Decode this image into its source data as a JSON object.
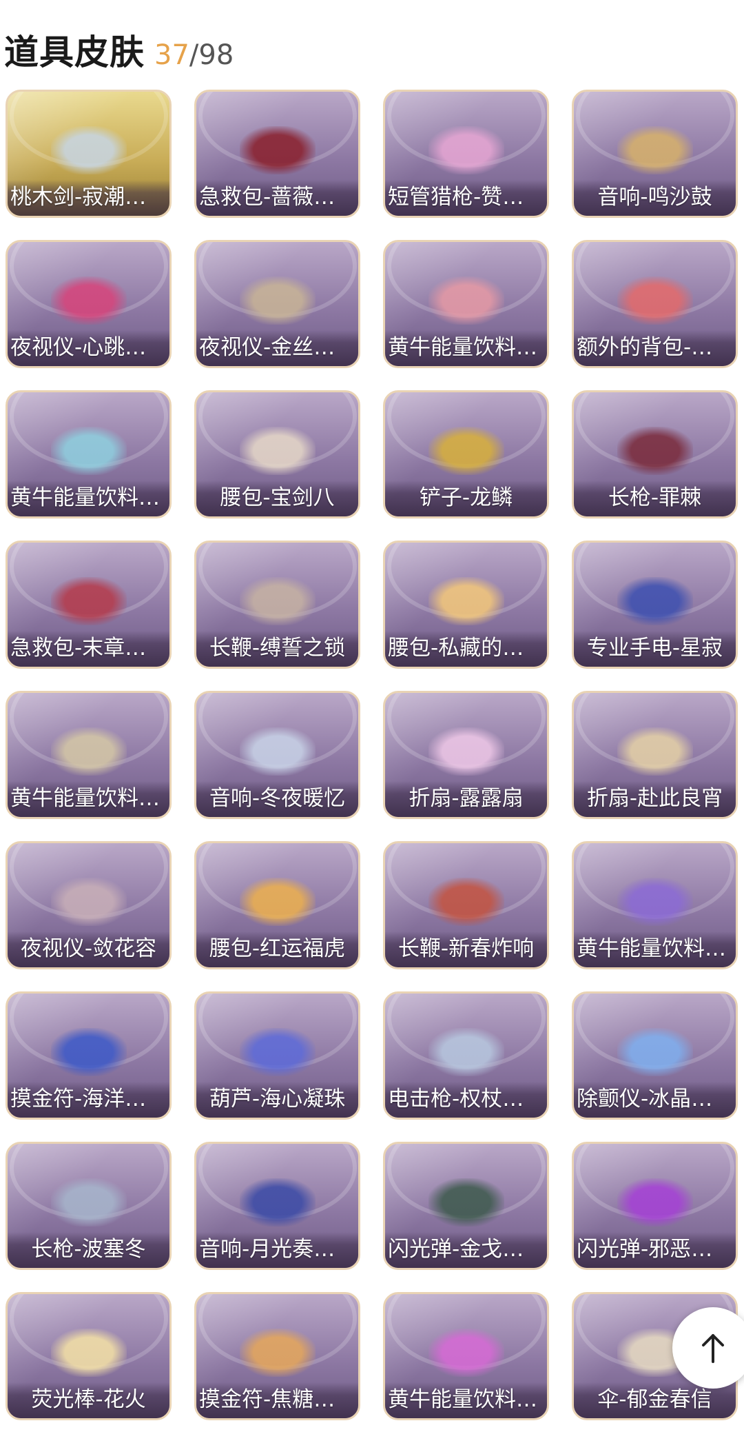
{
  "header": {
    "title": "道具皮肤",
    "owned": "37",
    "separator": "/",
    "total": "98"
  },
  "items": [
    {
      "label": "桃木剑-寂潮之…",
      "style": "gold",
      "art": "#c7d6e6"
    },
    {
      "label": "急救包-蔷薇物…",
      "style": "purple",
      "art": "#8a1f2b"
    },
    {
      "label": "短管猎枪-赞萌…",
      "style": "purple",
      "art": "#e8a7d4"
    },
    {
      "label": "音响-鸣沙鼓",
      "style": "purple",
      "art": "#d8b26a"
    },
    {
      "label": "夜视仪-心跳眼…",
      "style": "purple",
      "art": "#d8437a"
    },
    {
      "label": "夜视仪-金丝眼…",
      "style": "purple",
      "art": "#c9b596"
    },
    {
      "label": "黄牛能量饮料-…",
      "style": "purple",
      "art": "#e79aa5"
    },
    {
      "label": "额外的背包-飞…",
      "style": "purple",
      "art": "#e56a6a"
    },
    {
      "label": "黄牛能量饮料-…",
      "style": "purple",
      "art": "#8fd1e0"
    },
    {
      "label": "腰包-宝剑八",
      "style": "purple",
      "art": "#e7d9c8"
    },
    {
      "label": "铲子-龙鳞",
      "style": "purple",
      "art": "#d9b13a"
    },
    {
      "label": "长枪-罪棘",
      "style": "purple",
      "art": "#7a2a3a"
    },
    {
      "label": "急救包-末章心…",
      "style": "purple",
      "art": "#b53a4a"
    },
    {
      "label": "长鞭-缚誓之锁",
      "style": "purple",
      "art": "#c7b3a3"
    },
    {
      "label": "腰包-私藏的银…",
      "style": "purple",
      "art": "#f5c97a"
    },
    {
      "label": "专业手电-星寂",
      "style": "purple",
      "art": "#3c4fb0"
    },
    {
      "label": "黄牛能量饮料-…",
      "style": "purple",
      "art": "#d6c9a6"
    },
    {
      "label": "音响-冬夜暖忆",
      "style": "purple",
      "art": "#c9d4e8"
    },
    {
      "label": "折扇-露露扇",
      "style": "purple",
      "art": "#f0c9e8"
    },
    {
      "label": "折扇-赴此良宵",
      "style": "purple",
      "art": "#e6d2a6"
    },
    {
      "label": "夜视仪-敛花容",
      "style": "purple",
      "art": "#c9b0b8"
    },
    {
      "label": "腰包-红运福虎",
      "style": "purple",
      "art": "#eeb14d"
    },
    {
      "label": "长鞭-新春炸响",
      "style": "purple",
      "art": "#c4533f"
    },
    {
      "label": "黄牛能量饮料-…",
      "style": "purple",
      "art": "#8b6ad6"
    },
    {
      "label": "摸金符-海洋之…",
      "style": "purple",
      "art": "#3c59c8"
    },
    {
      "label": "葫芦-海心凝珠",
      "style": "purple",
      "art": "#5c6ad9"
    },
    {
      "label": "电击枪-权杖的…",
      "style": "purple",
      "art": "#b8c9e0"
    },
    {
      "label": "除颤仪-冰晶般…",
      "style": "purple",
      "art": "#7fb0f0"
    },
    {
      "label": "长枪-波塞冬",
      "style": "purple",
      "art": "#a7b6cc"
    },
    {
      "label": "音响-月光奏鸣…",
      "style": "purple",
      "art": "#3a4aa6"
    },
    {
      "label": "闪光弹-金戈玄…",
      "style": "purple",
      "art": "#3d5a4c"
    },
    {
      "label": "闪光弹-邪恶滚…",
      "style": "purple",
      "art": "#a53fd6"
    },
    {
      "label": "荧光棒-花火",
      "style": "purple",
      "art": "#f6e3a6"
    },
    {
      "label": "摸金符-焦糖纪…",
      "style": "purple",
      "art": "#e7a85a"
    },
    {
      "label": "黄牛能量饮料-…",
      "style": "purple",
      "art": "#d86ad6"
    },
    {
      "label": "伞-郁金春信",
      "style": "purple",
      "art": "#e8dcc2"
    }
  ],
  "back_to_top": {
    "icon": "arrow-up-icon"
  }
}
